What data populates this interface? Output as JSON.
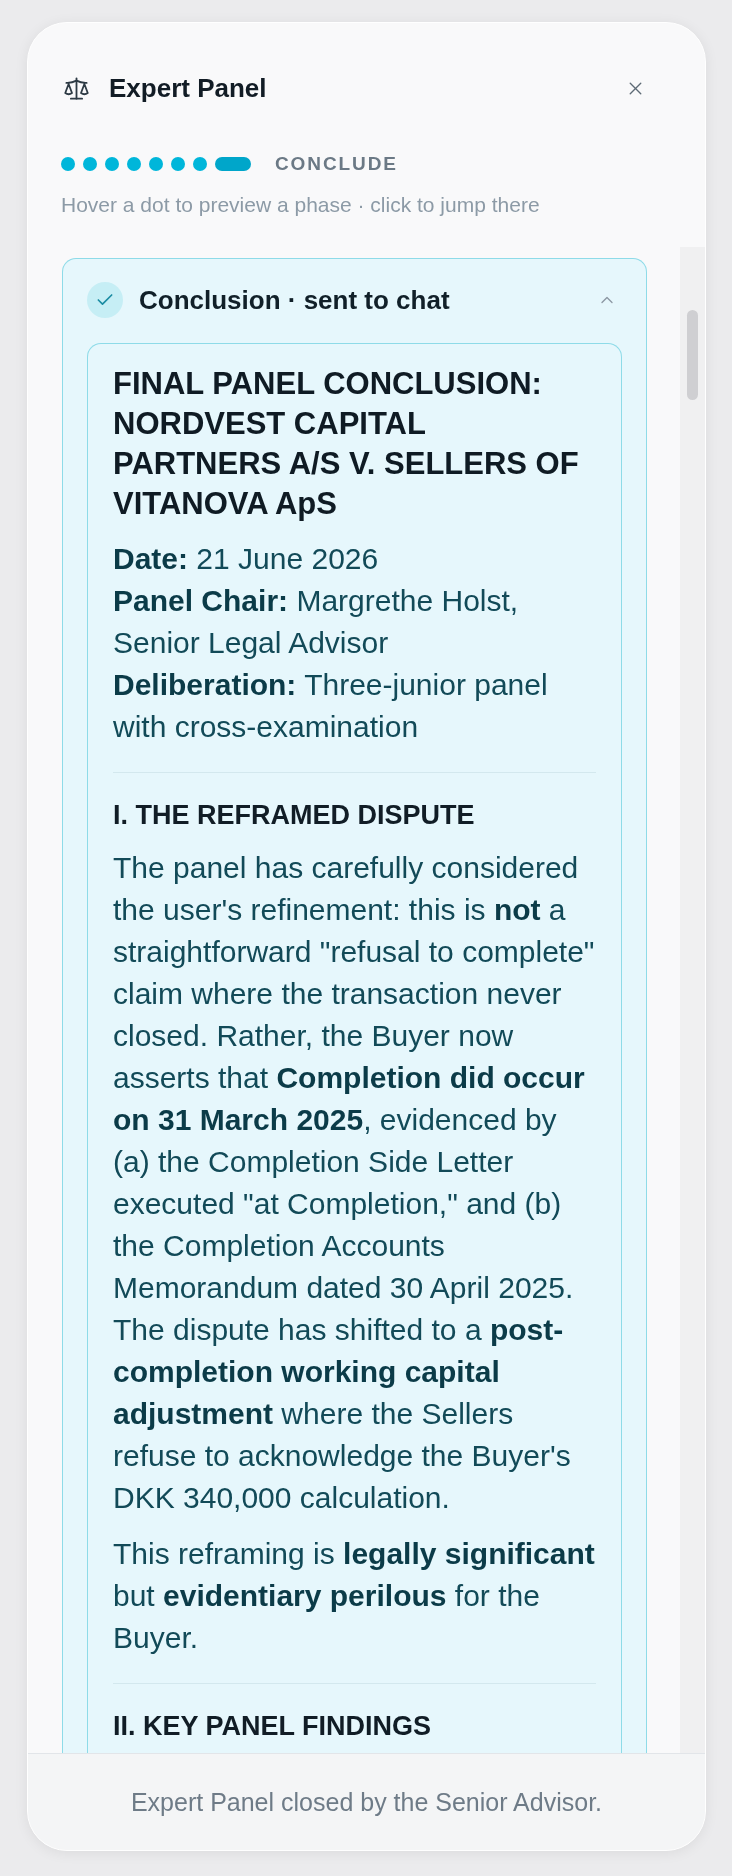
{
  "panel": {
    "title": "Expert Panel"
  },
  "progress": {
    "phases": [
      {
        "selected": false
      },
      {
        "selected": false
      },
      {
        "selected": false
      },
      {
        "selected": false
      },
      {
        "selected": false
      },
      {
        "selected": false
      },
      {
        "selected": false
      },
      {
        "selected": true
      }
    ],
    "current_phase": "CONCLUDE",
    "hint": "Hover a dot to preview a phase · click to jump there"
  },
  "conclusion": {
    "title": "Conclusion · sent to chat",
    "expanded": true,
    "document": {
      "title": "FINAL PANEL CONCLUSION: NORDVEST CAPITAL PARTNERS A/S V. SELLERS OF VITANOVA ApS",
      "meta": [
        {
          "label": "Date:",
          "value": "21 June 2026"
        },
        {
          "label": "Panel Chair:",
          "value": "Margrethe Holst, Senior Legal Advisor"
        },
        {
          "label": "Deliberation:",
          "value": "Three-junior panel with cross-examination"
        }
      ],
      "sections": [
        {
          "heading": "I. THE REFRAMED DISPUTE",
          "paragraphs": [
            "The panel has carefully considered the user's refinement: this is **not** a straightforward \"refusal to complete\" claim where the transaction never closed. Rather, the Buyer now asserts that **Completion did occur on 31 March 2025**, evidenced by (a) the Completion Side Letter executed \"at Completion,\" and (b) the Completion Accounts Memorandum dated 30 April 2025. The dispute has shifted to a **post-completion working capital adjustment** where the Sellers refuse to acknowledge the Buyer's DKK 340,000 calculation.",
            "This reframing is **legally significant** but **evidentiary perilous** for the Buyer."
          ]
        },
        {
          "heading": "II. KEY PANEL FINDINGS"
        }
      ]
    }
  },
  "footer": {
    "message": "Expert Panel closed by the Senior Advisor."
  }
}
